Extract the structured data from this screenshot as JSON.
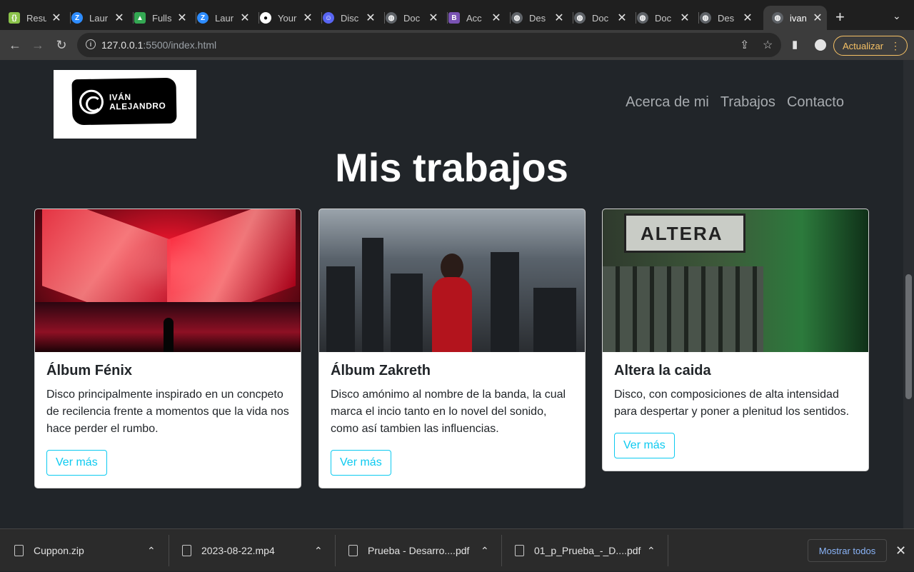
{
  "browser": {
    "tabs": [
      {
        "title": "Resu",
        "icon": "code-icon",
        "color": "#8bc34a"
      },
      {
        "title": "Laur",
        "icon": "zoom-icon",
        "color": "#2d8cff"
      },
      {
        "title": "Fulls",
        "icon": "drive-icon",
        "color": "#34a853"
      },
      {
        "title": "Laur",
        "icon": "zoom-icon",
        "color": "#2d8cff"
      },
      {
        "title": "Your",
        "icon": "github-icon",
        "color": "#ffffff"
      },
      {
        "title": "Disc",
        "icon": "discord-icon",
        "color": "#5865f2"
      },
      {
        "title": "Doc",
        "icon": "globe-icon",
        "color": "#9aa0a6"
      },
      {
        "title": "Acc",
        "icon": "bootstrap-icon",
        "color": "#7952b3"
      },
      {
        "title": "Des",
        "icon": "globe-icon",
        "color": "#9aa0a6"
      },
      {
        "title": "Doc",
        "icon": "globe-icon",
        "color": "#9aa0a6"
      },
      {
        "title": "Doc",
        "icon": "globe-icon",
        "color": "#9aa0a6"
      },
      {
        "title": "Des",
        "icon": "globe-icon",
        "color": "#9aa0a6"
      },
      {
        "title": "ivan",
        "icon": "globe-icon",
        "color": "#9aa0a6",
        "active": true
      }
    ],
    "url_host": "127.0.0.1",
    "url_rest": ":5500/index.html",
    "update_label": "Actualizar"
  },
  "site": {
    "logo_text_line1": "IVÁN",
    "logo_text_line2": "ALEJANDRO",
    "nav": [
      "Acerca de mi",
      "Trabajos",
      "Contacto"
    ],
    "heading": "Mis trabajos",
    "cards": [
      {
        "title": "Álbum Fénix",
        "text": "Disco principalmente inspirado en un concpeto de recilencia frente a momentos que la vida nos hace perder el rumbo.",
        "button": "Ver más"
      },
      {
        "title": "Álbum Zakreth",
        "text": "Disco amónimo al nombre de la banda, la cual marca el incio tanto en lo novel del sonido, como así tambien las influencias.",
        "button": "Ver más"
      },
      {
        "title": "Altera la caida",
        "text": "Disco, con composiciones de alta intensidad para despertar y poner a plenitud los sentidos.",
        "button": "Ver más",
        "image_sign": "ALTERA"
      }
    ],
    "accent_color": "#0dcaf0"
  },
  "downloads": {
    "items": [
      "Cuppon.zip",
      "2023-08-22.mp4",
      "Prueba - Desarro....pdf",
      "01_p_Prueba_-_D....pdf"
    ],
    "show_all": "Mostrar todos"
  }
}
